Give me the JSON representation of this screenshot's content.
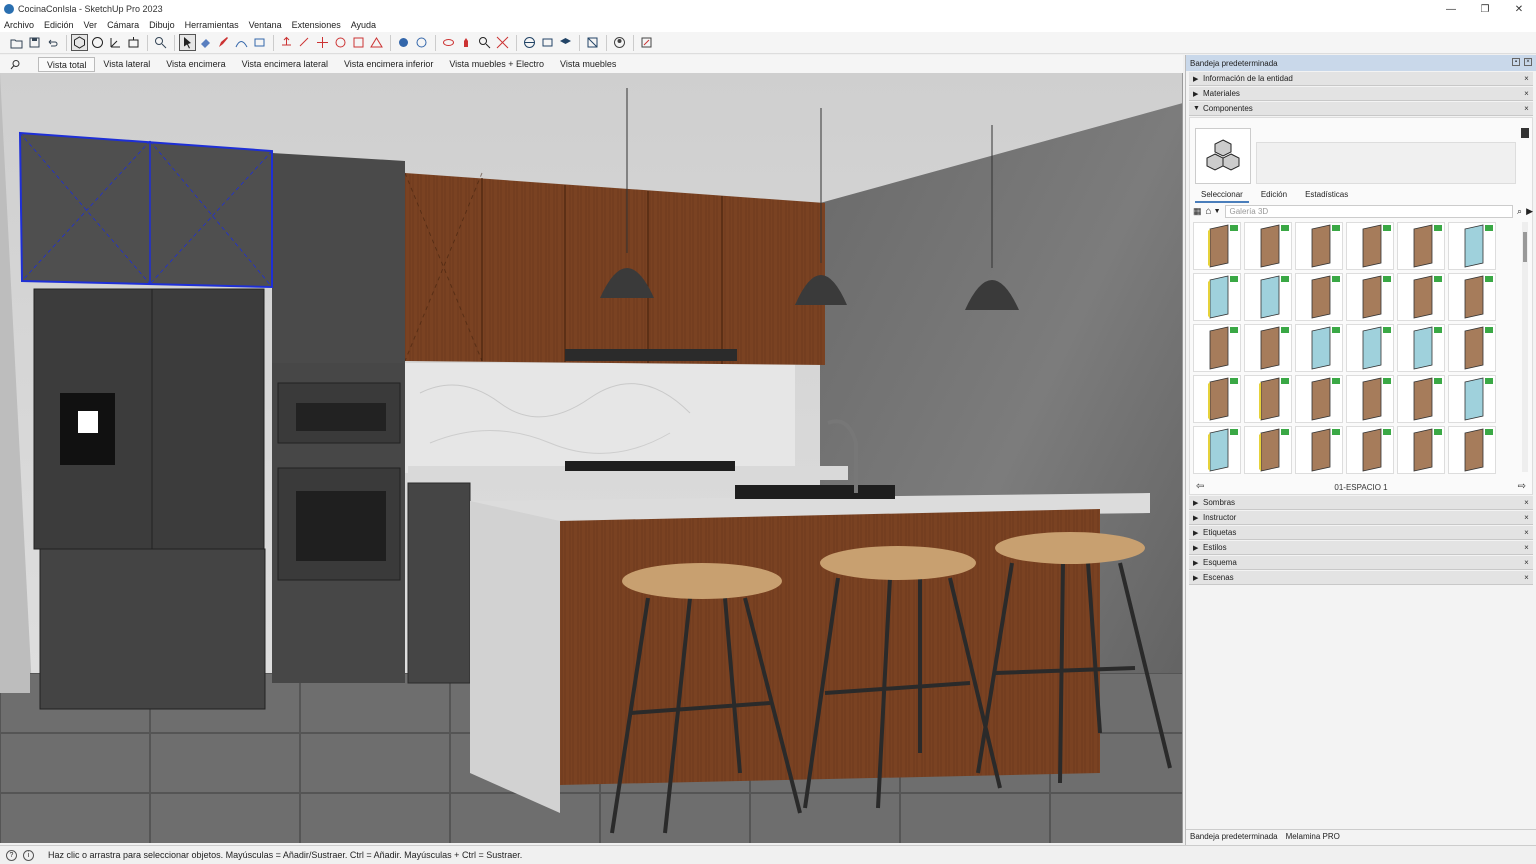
{
  "window": {
    "title": "CocinaConIsla - SketchUp Pro 2023",
    "controls": [
      "—",
      "❐",
      "✕"
    ]
  },
  "menu": [
    "Archivo",
    "Edición",
    "Ver",
    "Cámara",
    "Dibujo",
    "Herramientas",
    "Ventana",
    "Extensiones",
    "Ayuda"
  ],
  "toolbar": {
    "icons": [
      "select-icon",
      "line-icon",
      "eraser-icon",
      "tape-icon",
      "paint-icon",
      "rect-icon",
      "circle-icon",
      "pushpull-icon",
      "move-icon",
      "rotate-icon",
      "scale-icon",
      "offset-icon",
      "orbit-icon",
      "pan-icon",
      "zoom-icon",
      "zoom-extents-icon",
      "section-icon",
      "warehouse-icon",
      "extension-icon",
      "styles-icon"
    ]
  },
  "scenes": [
    "Vista total",
    "Vista lateral",
    "Vista encimera",
    "Vista encimera lateral",
    "Vista encimera inferior",
    "Vista muebles + Electro",
    "Vista muebles"
  ],
  "tray": {
    "title": "Bandeja predeterminada",
    "panels_top": [
      {
        "label": "Información de la entidad",
        "expanded": false
      },
      {
        "label": "Materiales",
        "expanded": false
      },
      {
        "label": "Componentes",
        "expanded": true
      }
    ],
    "components": {
      "tabs": [
        "Seleccionar",
        "Edición",
        "Estadísticas"
      ],
      "search_placeholder": "Galería 3D",
      "footer": "01-ESPACIO 1",
      "thumb_count": 30
    },
    "panels_bottom": [
      "Sombras",
      "Instructor",
      "Etiquetas",
      "Estilos",
      "Esquema",
      "Escenas"
    ],
    "bottom_tabs": [
      "Bandeja predeterminada",
      "Melamina PRO"
    ]
  },
  "status": {
    "text": "Haz clic o arrastra para seleccionar objetos. Mayúsculas = Añadir/Sustraer. Ctrl = Añadir. Mayúsculas + Ctrl = Sustraer."
  }
}
